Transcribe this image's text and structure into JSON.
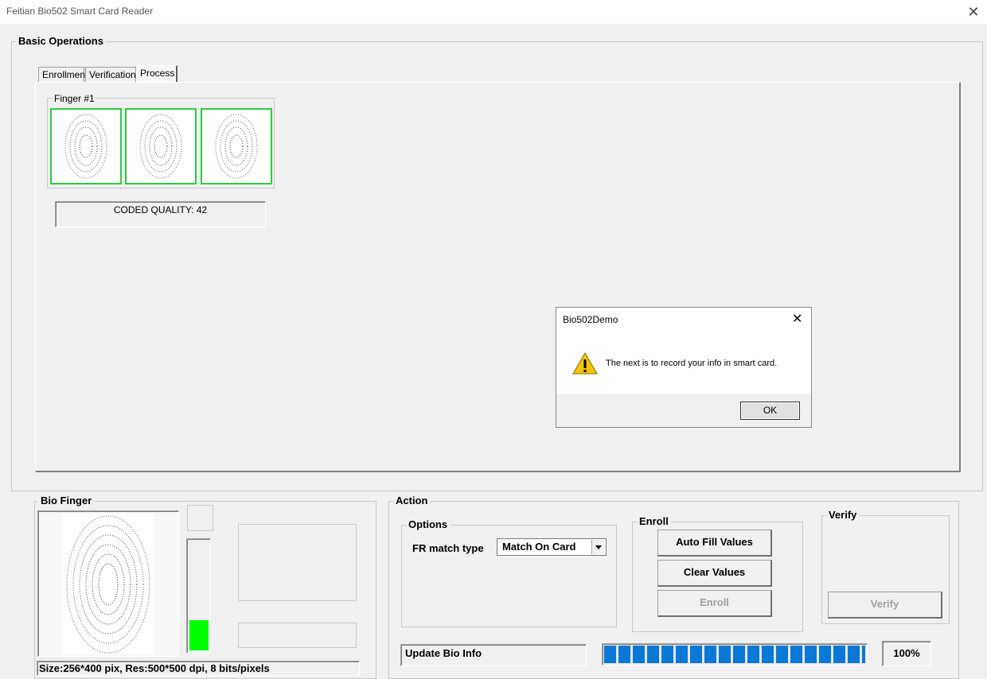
{
  "window": {
    "title": "Feitian Bio502 Smart Card Reader",
    "close_glyph": "✕"
  },
  "basic_operations": {
    "label": "Basic Operations",
    "tabs": [
      {
        "label": "Enrollment"
      },
      {
        "label": "Verification"
      },
      {
        "label": "Process",
        "active": true
      }
    ],
    "finger_group_label": "Finger #1",
    "coded_quality": "CODED QUALITY: 42"
  },
  "dialog": {
    "title": "Bio502Demo",
    "close_glyph": "✕",
    "message": "The next is to record your info in smart card.",
    "icon": "warning-icon",
    "ok_label": "OK"
  },
  "bio_finger": {
    "label": "Bio Finger",
    "status": "Size:256*400 pix, Res:500*500 dpi, 8 bits/pixels",
    "quality_level": 0.28,
    "quality_color": "#00ff00"
  },
  "action": {
    "label": "Action",
    "options": {
      "label": "Options",
      "fr_match_label": "FR match type",
      "fr_match_value": "Match On Card"
    },
    "enroll": {
      "label": "Enroll",
      "auto_fill": "Auto Fill Values",
      "clear": "Clear Values",
      "enroll": "Enroll"
    },
    "verify": {
      "label": "Verify",
      "verify": "Verify"
    },
    "status_text": "Update Bio Info",
    "progress_percent": "100%",
    "progress_value": 1.0,
    "progress_color": "#0a78d7"
  }
}
